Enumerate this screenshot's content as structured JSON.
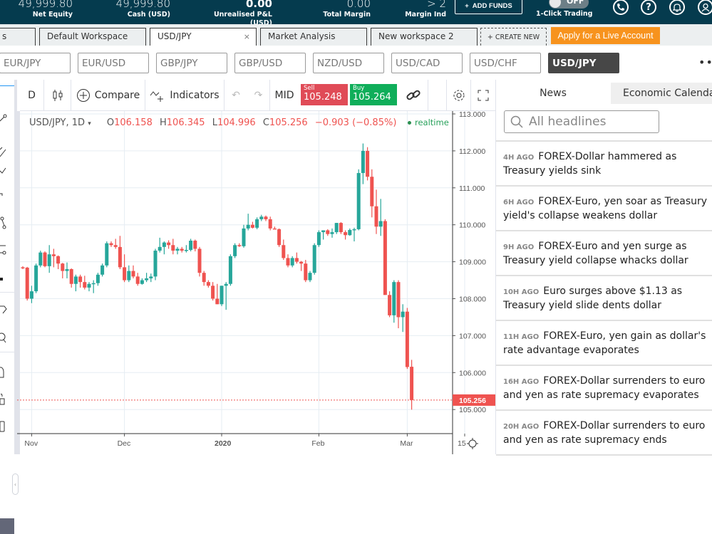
{
  "account": {
    "stats": [
      {
        "value": "49,999.80",
        "label": "Net Equity"
      },
      {
        "value": "49,999.80",
        "label": "Cash (USD)"
      },
      {
        "value": "0.00",
        "label": "Unrealised P&L (USD)"
      },
      {
        "value": "0.00",
        "label": "Total Margin"
      },
      {
        "value": "> 2",
        "label": "Margin Ind"
      }
    ],
    "add_funds_label": "ADD FUNDS",
    "one_click": {
      "label": "1-Click Trading",
      "state": "OFF"
    },
    "icons": [
      "phone-icon",
      "help-icon",
      "bell-icon",
      "user-icon"
    ]
  },
  "workspace_tabs": {
    "tabs": [
      {
        "label": "s",
        "active": false
      },
      {
        "label": "Default Workspace",
        "active": false
      },
      {
        "label": "USD/JPY",
        "active": true,
        "closable": true
      },
      {
        "label": "Market Analysis",
        "active": false
      },
      {
        "label": "New workspace 2",
        "active": false
      }
    ],
    "create_new_label": "+ CREATE NEW",
    "apply_label": "Apply for a Live Account",
    "close_glyph": "×"
  },
  "instruments": {
    "items": [
      "EUR/JPY",
      "EUR/USD",
      "GBP/JPY",
      "GBP/USD",
      "NZD/USD",
      "USD/CAD",
      "USD/CHF",
      "USD/JPY"
    ],
    "active": "USD/JPY",
    "more": "•••"
  },
  "chart_toolbar": {
    "interval": "D",
    "compare_label": "Compare",
    "indicators_label": "Indicators",
    "mid_label": "MID",
    "sell": {
      "label": "Sell",
      "price": "105.248"
    },
    "buy": {
      "label": "Buy",
      "price": "105.264"
    }
  },
  "chart_legend": {
    "symbol": "USD/JPY, 1D",
    "o_label": "O",
    "o": "106.158",
    "h_label": "H",
    "h": "106.345",
    "l_label": "L",
    "l": "104.996",
    "c_label": "C",
    "c": "105.256",
    "change": "−0.903 (−0.85%)",
    "status": "realtime"
  },
  "colors": {
    "up": "#26a69a",
    "down": "#ef5350",
    "brand": "#053b4e",
    "accent": "#f7931e"
  },
  "chart_data": {
    "type": "candlestick",
    "title": "USD/JPY, 1D",
    "ylim": [
      104.85,
      113.05
    ],
    "y_ticks": [
      "113.000",
      "112.000",
      "111.000",
      "110.000",
      "109.000",
      "108.000",
      "107.000",
      "106.000",
      "105.000"
    ],
    "y_tick_values": [
      113,
      112,
      111,
      110,
      109,
      108,
      107,
      106,
      105
    ],
    "x_labels": [
      {
        "label": "Nov",
        "bar": 2,
        "bold": false
      },
      {
        "label": "Dec",
        "bar": 23,
        "bold": false
      },
      {
        "label": "2020",
        "bar": 45,
        "bold": true
      },
      {
        "label": "Feb",
        "bar": 67,
        "bold": false
      },
      {
        "label": "Mar",
        "bar": 87,
        "bold": false
      },
      {
        "label": "15",
        "bar": 100,
        "bold": false
      }
    ],
    "last_price": "105.256",
    "last_value": 105.256,
    "bars": [
      [
        108.85,
        108.88,
        108.8,
        108.84
      ],
      [
        108.84,
        108.86,
        107.95,
        108.0
      ],
      [
        108.0,
        108.35,
        107.88,
        108.2
      ],
      [
        108.2,
        108.95,
        108.15,
        108.9
      ],
      [
        108.9,
        109.3,
        108.85,
        109.25
      ],
      [
        109.25,
        109.28,
        108.85,
        108.88
      ],
      [
        108.88,
        109.45,
        108.7,
        109.2
      ],
      [
        109.2,
        109.35,
        108.85,
        109.15
      ],
      [
        109.15,
        109.17,
        108.8,
        108.95
      ],
      [
        108.95,
        108.97,
        108.55,
        108.75
      ],
      [
        108.75,
        108.98,
        108.55,
        108.8
      ],
      [
        108.8,
        108.82,
        108.3,
        108.4
      ],
      [
        108.4,
        108.65,
        108.2,
        108.6
      ],
      [
        108.6,
        108.65,
        108.3,
        108.45
      ],
      [
        108.45,
        108.62,
        108.25,
        108.3
      ],
      [
        108.3,
        108.45,
        108.2,
        108.4
      ],
      [
        108.4,
        108.5,
        108.15,
        108.42
      ],
      [
        108.42,
        108.7,
        108.35,
        108.65
      ],
      [
        108.65,
        108.95,
        108.6,
        108.9
      ],
      [
        108.9,
        109.55,
        108.85,
        109.5
      ],
      [
        109.5,
        109.55,
        109.4,
        109.45
      ],
      [
        109.45,
        109.62,
        109.35,
        109.4
      ],
      [
        109.4,
        109.7,
        108.8,
        108.85
      ],
      [
        108.85,
        109.2,
        108.45,
        108.5
      ],
      [
        108.5,
        108.9,
        108.45,
        108.75
      ],
      [
        108.75,
        108.9,
        108.55,
        108.6
      ],
      [
        108.6,
        108.7,
        108.35,
        108.4
      ],
      [
        108.4,
        108.55,
        108.38,
        108.5
      ],
      [
        108.5,
        108.7,
        108.45,
        108.55
      ],
      [
        108.55,
        108.68,
        108.45,
        108.6
      ],
      [
        108.6,
        109.35,
        108.5,
        109.3
      ],
      [
        109.3,
        109.65,
        109.25,
        109.4
      ],
      [
        109.4,
        109.55,
        109.2,
        109.52
      ],
      [
        109.52,
        109.58,
        109.35,
        109.45
      ],
      [
        109.45,
        109.62,
        109.2,
        109.3
      ],
      [
        109.3,
        109.4,
        109.2,
        109.35
      ],
      [
        109.35,
        109.4,
        109.25,
        109.3
      ],
      [
        109.3,
        109.45,
        109.25,
        109.32
      ],
      [
        109.32,
        109.62,
        109.28,
        109.57
      ],
      [
        109.57,
        109.6,
        109.28,
        109.35
      ],
      [
        109.35,
        109.4,
        108.6,
        108.7
      ],
      [
        108.7,
        108.75,
        108.35,
        108.45
      ],
      [
        108.45,
        108.5,
        108.3,
        108.35
      ],
      [
        108.35,
        108.45,
        107.95,
        108.0
      ],
      [
        108.0,
        108.4,
        107.85,
        107.85
      ],
      [
        107.85,
        108.35,
        107.8,
        108.35
      ],
      [
        108.35,
        108.45,
        107.7,
        108.4
      ],
      [
        108.4,
        109.2,
        108.35,
        109.15
      ],
      [
        109.15,
        109.5,
        109.1,
        109.45
      ],
      [
        109.45,
        109.5,
        109.4,
        109.42
      ],
      [
        109.42,
        110.0,
        109.38,
        109.9
      ],
      [
        109.9,
        110.3,
        109.85,
        110.0
      ],
      [
        110.0,
        110.08,
        109.9,
        109.92
      ],
      [
        109.92,
        110.2,
        109.88,
        110.15
      ],
      [
        110.15,
        110.27,
        110.1,
        110.22
      ],
      [
        110.22,
        110.25,
        110.1,
        110.15
      ],
      [
        110.15,
        110.22,
        109.85,
        109.9
      ],
      [
        109.9,
        109.95,
        109.88,
        109.88
      ],
      [
        109.88,
        109.9,
        109.4,
        109.45
      ],
      [
        109.45,
        109.6,
        109.05,
        109.1
      ],
      [
        109.1,
        109.2,
        108.85,
        108.9
      ],
      [
        108.9,
        109.15,
        108.85,
        109.1
      ],
      [
        109.1,
        109.25,
        108.95,
        109.0
      ],
      [
        109.0,
        109.02,
        108.75,
        108.95
      ],
      [
        108.95,
        109.05,
        108.45,
        108.5
      ],
      [
        108.5,
        108.75,
        108.45,
        108.7
      ],
      [
        108.7,
        109.5,
        108.65,
        109.45
      ],
      [
        109.45,
        109.85,
        109.4,
        109.8
      ],
      [
        109.8,
        109.82,
        109.6,
        109.85
      ],
      [
        109.85,
        109.88,
        109.7,
        109.75
      ],
      [
        109.75,
        109.9,
        109.65,
        109.8
      ],
      [
        109.8,
        110.05,
        109.75,
        110.05
      ],
      [
        110.05,
        110.07,
        109.75,
        109.8
      ],
      [
        109.8,
        109.85,
        109.6,
        109.72
      ],
      [
        109.72,
        109.9,
        109.7,
        109.86
      ],
      [
        109.86,
        109.92,
        109.55,
        109.88
      ],
      [
        109.88,
        111.5,
        109.85,
        111.4
      ],
      [
        111.4,
        112.2,
        111.1,
        112.0
      ],
      [
        112.0,
        112.1,
        111.2,
        111.3
      ],
      [
        111.3,
        111.5,
        110.2,
        110.5
      ],
      [
        110.5,
        110.95,
        109.75,
        109.95
      ],
      [
        109.95,
        110.7,
        109.7,
        110.1
      ],
      [
        110.1,
        110.15,
        108.3,
        108.1
      ],
      [
        108.1,
        108.2,
        107.5,
        107.55
      ],
      [
        107.55,
        108.5,
        107.35,
        108.45
      ],
      [
        108.45,
        108.5,
        107.2,
        107.5
      ],
      [
        107.5,
        107.85,
        107.1,
        107.65
      ],
      [
        107.65,
        107.75,
        106.1,
        106.15
      ],
      [
        106.158,
        106.345,
        104.996,
        105.256
      ]
    ]
  },
  "news": {
    "tabs": [
      "News",
      "Economic Calendar"
    ],
    "search_placeholder": "All headlines",
    "items": [
      {
        "ago": "4H AGO",
        "headline": "FOREX-Dollar hammered as Treasury yields sink"
      },
      {
        "ago": "6H AGO",
        "headline": "FOREX-Euro, yen soar as Treasury yield's collapse weakens dollar"
      },
      {
        "ago": "9H AGO",
        "headline": "FOREX-Euro and yen surge as Treasury yield collapse whacks dollar"
      },
      {
        "ago": "10H AGO",
        "headline": "Euro surges above $1.13 as Treasury yield slide dents dollar"
      },
      {
        "ago": "11H AGO",
        "headline": "FOREX-Euro, yen gain as dollar's rate advantage evaporates"
      },
      {
        "ago": "16H AGO",
        "headline": "FOREX-Dollar surrenders to euro and yen as rate supremacy evaporates"
      },
      {
        "ago": "20H AGO",
        "headline": "FOREX-Dollar surrenders to euro and yen as rate supremacy ends"
      }
    ]
  }
}
